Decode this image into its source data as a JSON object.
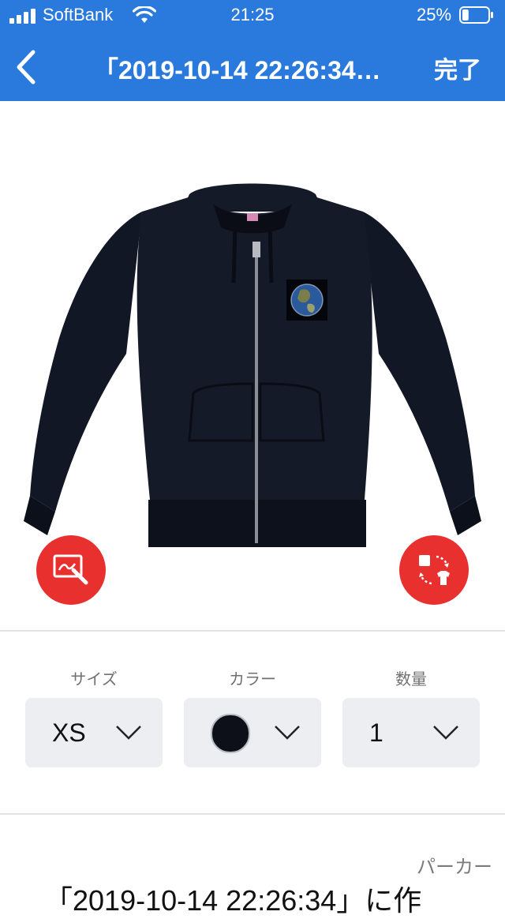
{
  "status_bar": {
    "carrier": "SoftBank",
    "time": "21:25",
    "battery_percent": "25%",
    "battery_level": 0.25
  },
  "nav": {
    "title": "「2019-10-14 22:26:34…",
    "done_label": "完了",
    "back_icon": "chevron-left-icon"
  },
  "product_image": {
    "garment": "zip hoodie",
    "color": "#0d1018",
    "print": "earth-image"
  },
  "actions": {
    "edit_icon": "edit-design-icon",
    "swap_icon": "change-item-icon",
    "accent_color": "#e8302f"
  },
  "options": {
    "size": {
      "label": "サイズ",
      "value": "XS"
    },
    "color": {
      "label": "カラー",
      "swatch": "#0d1018"
    },
    "quantity": {
      "label": "数量",
      "value": "1"
    }
  },
  "details": {
    "category": "パーカー",
    "name": "「2019-10-14 22:26:34」に作"
  }
}
